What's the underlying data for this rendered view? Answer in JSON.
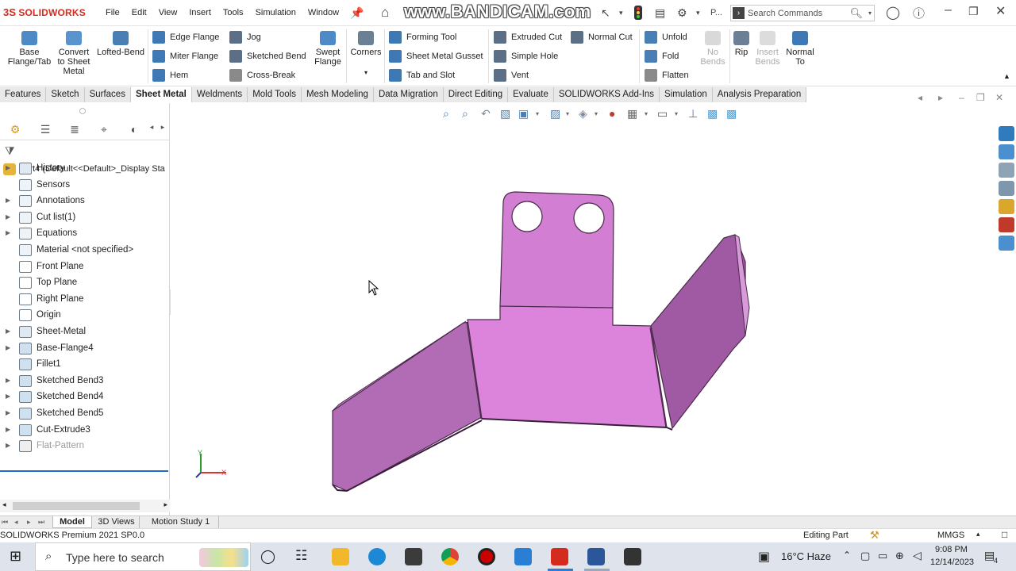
{
  "app": {
    "logo_prefix": "3S",
    "logo_text": "SOLIDWORKS",
    "menu": [
      "File",
      "Edit",
      "View",
      "Insert",
      "Tools",
      "Simulation",
      "Window"
    ],
    "watermark": "www.BANDICAM.com",
    "more_label": "P...",
    "search_placeholder": "Search Commands"
  },
  "ribbon": {
    "base_flange": "Base Flange/Tab",
    "convert": "Convert to Sheet Metal",
    "lofted": "Lofted-Bend",
    "edge_flange": "Edge Flange",
    "miter_flange": "Miter Flange",
    "hem": "Hem",
    "jog": "Jog",
    "sketched_bend": "Sketched Bend",
    "cross_break": "Cross-Break",
    "swept_flange": "Swept Flange",
    "corners": "Corners",
    "forming_tool": "Forming Tool",
    "gusset": "Sheet Metal Gusset",
    "tab_slot": "Tab and Slot",
    "extruded_cut": "Extruded Cut",
    "simple_hole": "Simple Hole",
    "vent": "Vent",
    "normal_cut": "Normal Cut",
    "unfold": "Unfold",
    "fold": "Fold",
    "flatten": "Flatten",
    "no_bends": "No Bends",
    "rip": "Rip",
    "insert_bends": "Insert Bends",
    "normal_to": "Normal To"
  },
  "tabs": [
    {
      "label": "Features"
    },
    {
      "label": "Sketch"
    },
    {
      "label": "Surfaces"
    },
    {
      "label": "Sheet Metal"
    },
    {
      "label": "Weldments"
    },
    {
      "label": "Mold Tools"
    },
    {
      "label": "Mesh Modeling"
    },
    {
      "label": "Data Migration"
    },
    {
      "label": "Direct Editing"
    },
    {
      "label": "Evaluate"
    },
    {
      "label": "SOLIDWORKS Add-Ins"
    },
    {
      "label": "Simulation"
    },
    {
      "label": "Analysis Preparation"
    }
  ],
  "active_tab": "Sheet Metal",
  "tree": {
    "root": "Part4  (Default<<Default>_Display Sta",
    "items": [
      {
        "label": "History"
      },
      {
        "label": "Sensors"
      },
      {
        "label": "Annotations"
      },
      {
        "label": "Cut list(1)"
      },
      {
        "label": "Equations"
      },
      {
        "label": "Material <not specified>"
      },
      {
        "label": "Front Plane"
      },
      {
        "label": "Top Plane"
      },
      {
        "label": "Right Plane"
      },
      {
        "label": "Origin"
      },
      {
        "label": "Sheet-Metal"
      },
      {
        "label": "Base-Flange4"
      },
      {
        "label": "Fillet1"
      },
      {
        "label": "Sketched Bend3"
      },
      {
        "label": "Sketched Bend4"
      },
      {
        "label": "Sketched Bend5"
      },
      {
        "label": "Cut-Extrude3"
      },
      {
        "label": "Flat-Pattern"
      }
    ]
  },
  "bottom_tabs": [
    "Model",
    "3D Views",
    "Motion Study 1"
  ],
  "status": {
    "left": "SOLIDWORKS Premium 2021 SP0.0",
    "mode": "Editing Part",
    "units": "MMGS"
  },
  "axes": {
    "x": "X",
    "y": "Y"
  },
  "taskbar": {
    "search_placeholder": "Type here to search",
    "weather": "16°C  Haze",
    "time": "9:08 PM",
    "date": "12/14/2023",
    "notifications": "4"
  },
  "colors": {
    "part_face": "#d67fd6",
    "part_dark": "#a85aa8",
    "brand": "#d52b1e",
    "selection_blue": "#1f6fbf"
  }
}
